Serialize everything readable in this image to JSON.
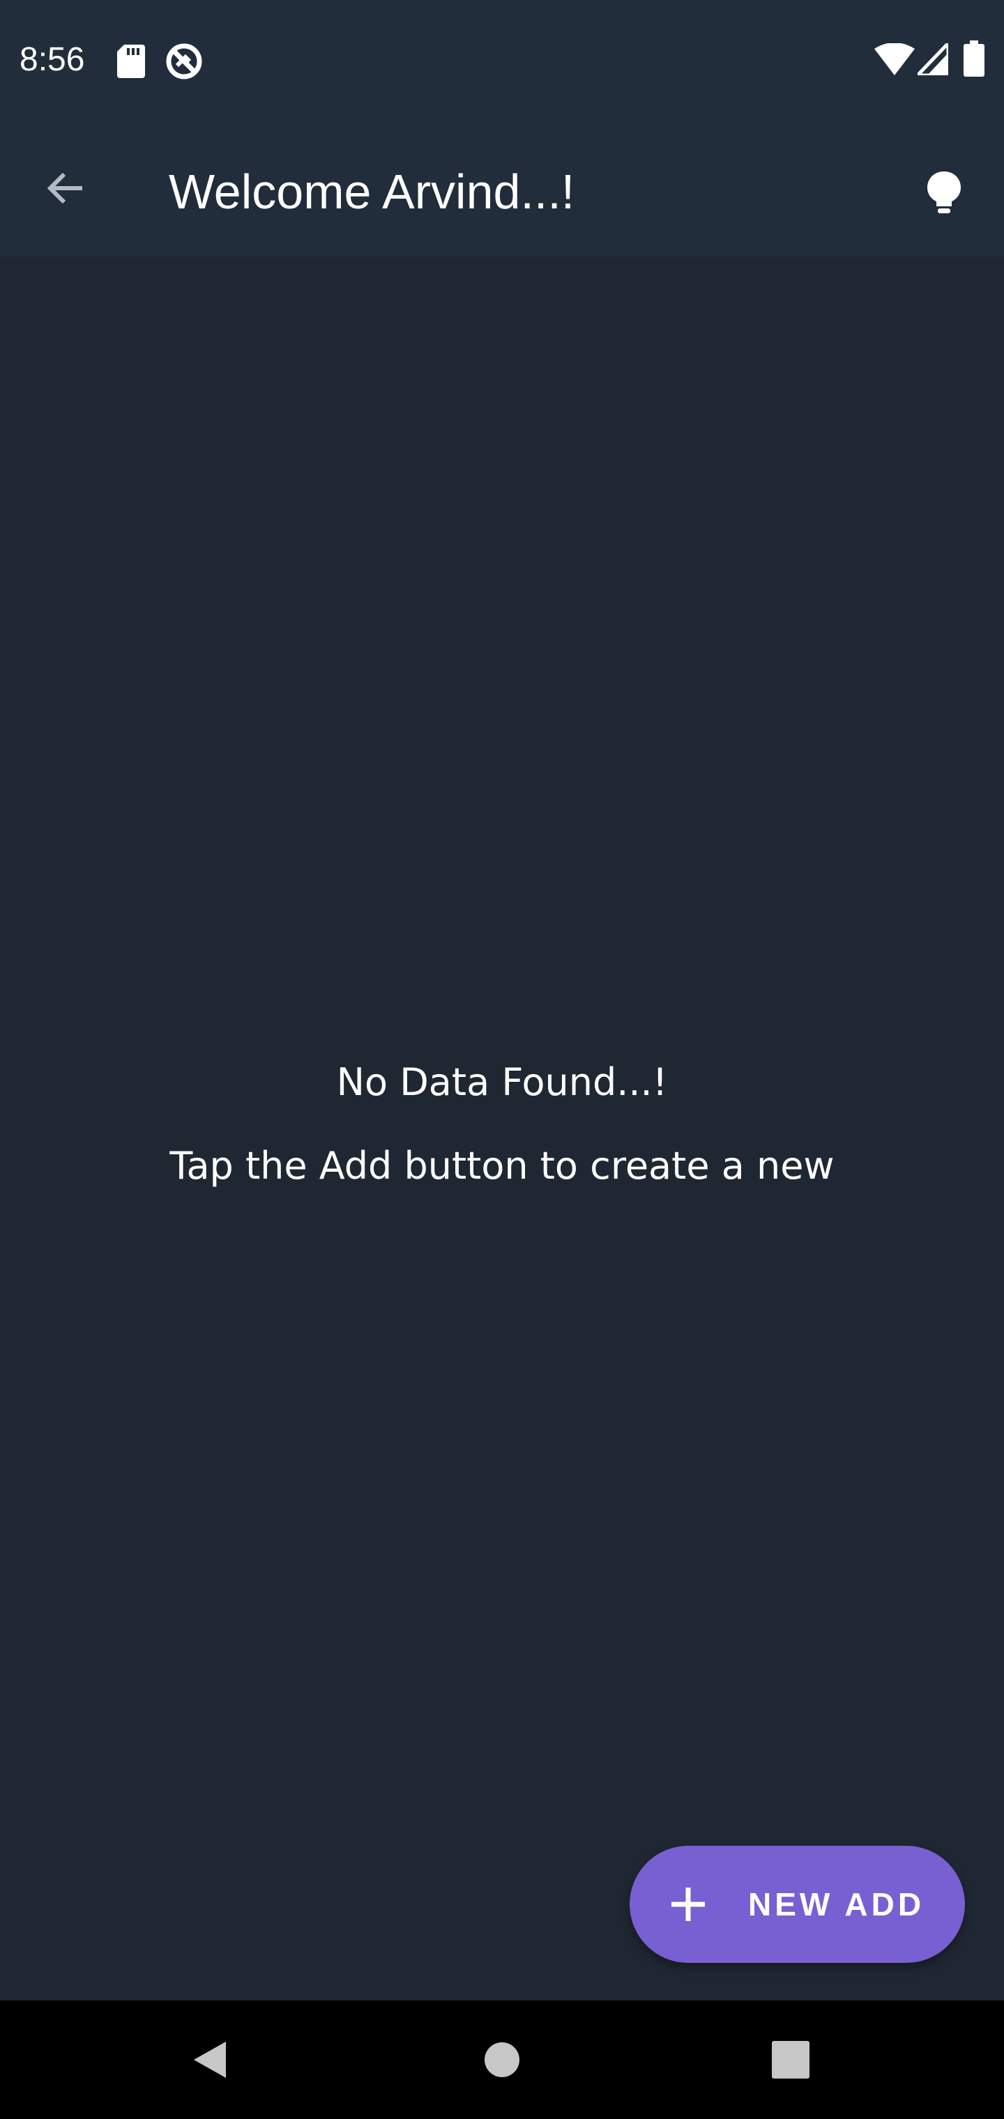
{
  "status_bar": {
    "time": "8:56",
    "icons": [
      "sd-card-icon",
      "data-saver-icon",
      "wifi-icon",
      "cell-signal-icon",
      "battery-icon"
    ]
  },
  "app_bar": {
    "back_icon": "arrow-back-icon",
    "title": "Welcome Arvind...!",
    "theme_icon": "lightbulb-icon"
  },
  "empty_state": {
    "title": "No Data Found...!",
    "subtitle": "Tap the Add button to create a new"
  },
  "fab": {
    "icon": "plus-icon",
    "label": "NEW ADD"
  },
  "nav_bar": {
    "icons": [
      "back-triangle-icon",
      "home-circle-icon",
      "recents-square-icon"
    ]
  },
  "colors": {
    "background": "#1f2733",
    "app_bar": "#222d3c",
    "accent": "#7860d2",
    "nav_bar": "#000000",
    "text": "#ffffff"
  }
}
